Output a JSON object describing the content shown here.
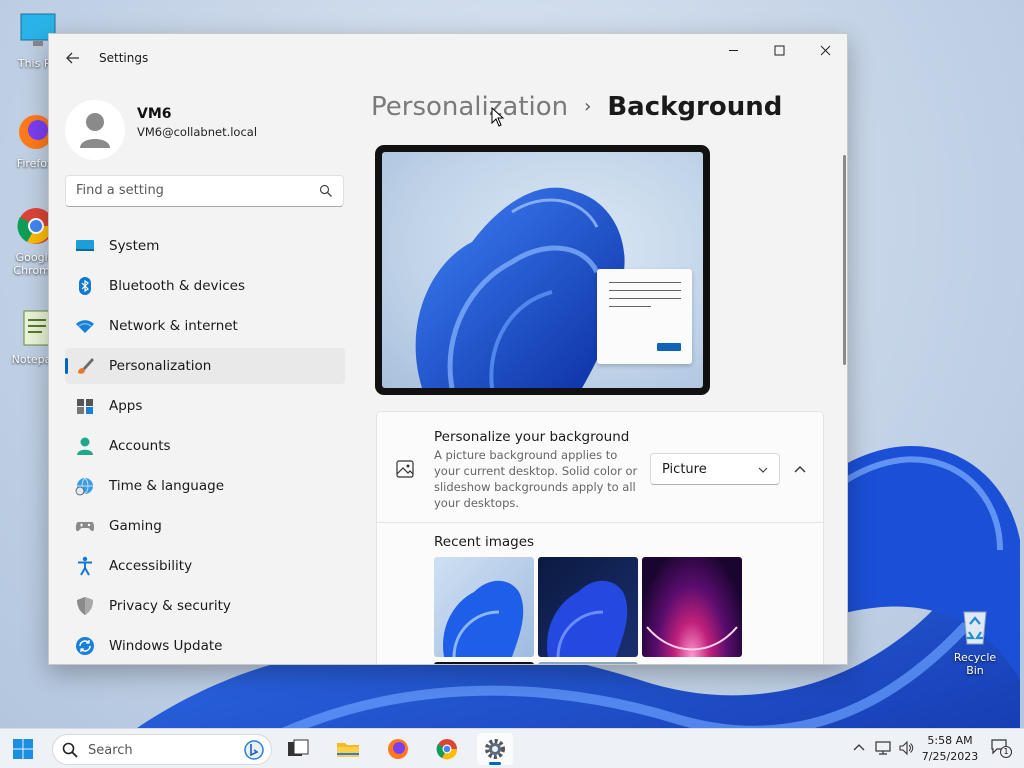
{
  "desktop": {
    "icons": [
      {
        "label": "This PC"
      },
      {
        "label": "Firefox"
      },
      {
        "label": "Google Chrome"
      },
      {
        "label": "Notepad"
      }
    ],
    "recycle_bin": "Recycle Bin"
  },
  "window": {
    "title": "Settings",
    "minimize_icon": "minimize-icon",
    "maximize_icon": "maximize-icon",
    "close_icon": "close-icon"
  },
  "profile": {
    "name": "VM6",
    "email": "VM6@collabnet.local"
  },
  "search": {
    "placeholder": "Find a setting"
  },
  "nav": {
    "items": [
      {
        "label": "System",
        "icon": "monitor-icon"
      },
      {
        "label": "Bluetooth & devices",
        "icon": "bluetooth-icon"
      },
      {
        "label": "Network & internet",
        "icon": "wifi-icon"
      },
      {
        "label": "Personalization",
        "icon": "brush-icon",
        "active": true
      },
      {
        "label": "Apps",
        "icon": "apps-icon"
      },
      {
        "label": "Accounts",
        "icon": "person-icon"
      },
      {
        "label": "Time & language",
        "icon": "globe-clock-icon"
      },
      {
        "label": "Gaming",
        "icon": "gamepad-icon"
      },
      {
        "label": "Accessibility",
        "icon": "accessibility-icon"
      },
      {
        "label": "Privacy & security",
        "icon": "shield-icon"
      },
      {
        "label": "Windows Update",
        "icon": "update-icon"
      }
    ]
  },
  "breadcrumb": {
    "parent": "Personalization",
    "separator": "›",
    "current": "Background"
  },
  "background_card": {
    "title": "Personalize your background",
    "description": "A picture background applies to your current desktop. Solid color or slideshow backgrounds apply to all your desktops.",
    "dropdown_value": "Picture",
    "recent_images_label": "Recent images"
  },
  "taskbar": {
    "search_placeholder": "Search",
    "time": "5:58 AM",
    "date": "7/25/2023",
    "notification_count": "1"
  },
  "colors": {
    "accent": "#0067c0"
  }
}
